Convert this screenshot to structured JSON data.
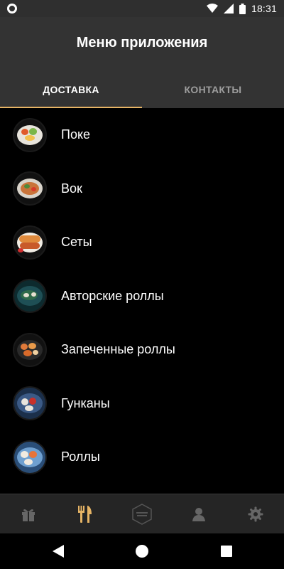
{
  "status_bar": {
    "time": "18:31",
    "icons": [
      "notification-dot-icon",
      "wifi-icon",
      "signal-icon",
      "battery-icon"
    ]
  },
  "header": {
    "title": "Меню приложения"
  },
  "tabs": [
    {
      "label": "ДОСТАВКА",
      "active": true
    },
    {
      "label": "КОНТАКТЫ",
      "active": false
    }
  ],
  "menu": {
    "items": [
      {
        "label": "Поке"
      },
      {
        "label": "Вок"
      },
      {
        "label": "Сеты"
      },
      {
        "label": "Авторские роллы"
      },
      {
        "label": "Запеченные роллы"
      },
      {
        "label": "Гунканы"
      },
      {
        "label": "Роллы"
      }
    ]
  },
  "bottom_nav": {
    "items": [
      {
        "icon": "gift-icon"
      },
      {
        "icon": "fork-knife-icon",
        "active": true
      },
      {
        "icon": "logo-hexagon-icon"
      },
      {
        "icon": "profile-icon"
      },
      {
        "icon": "gear-icon"
      }
    ]
  },
  "colors": {
    "accent": "#e6b465",
    "appbar": "#333333",
    "background": "#000000",
    "inactive": "#9e9e9e",
    "nav_bg": "#252525"
  }
}
